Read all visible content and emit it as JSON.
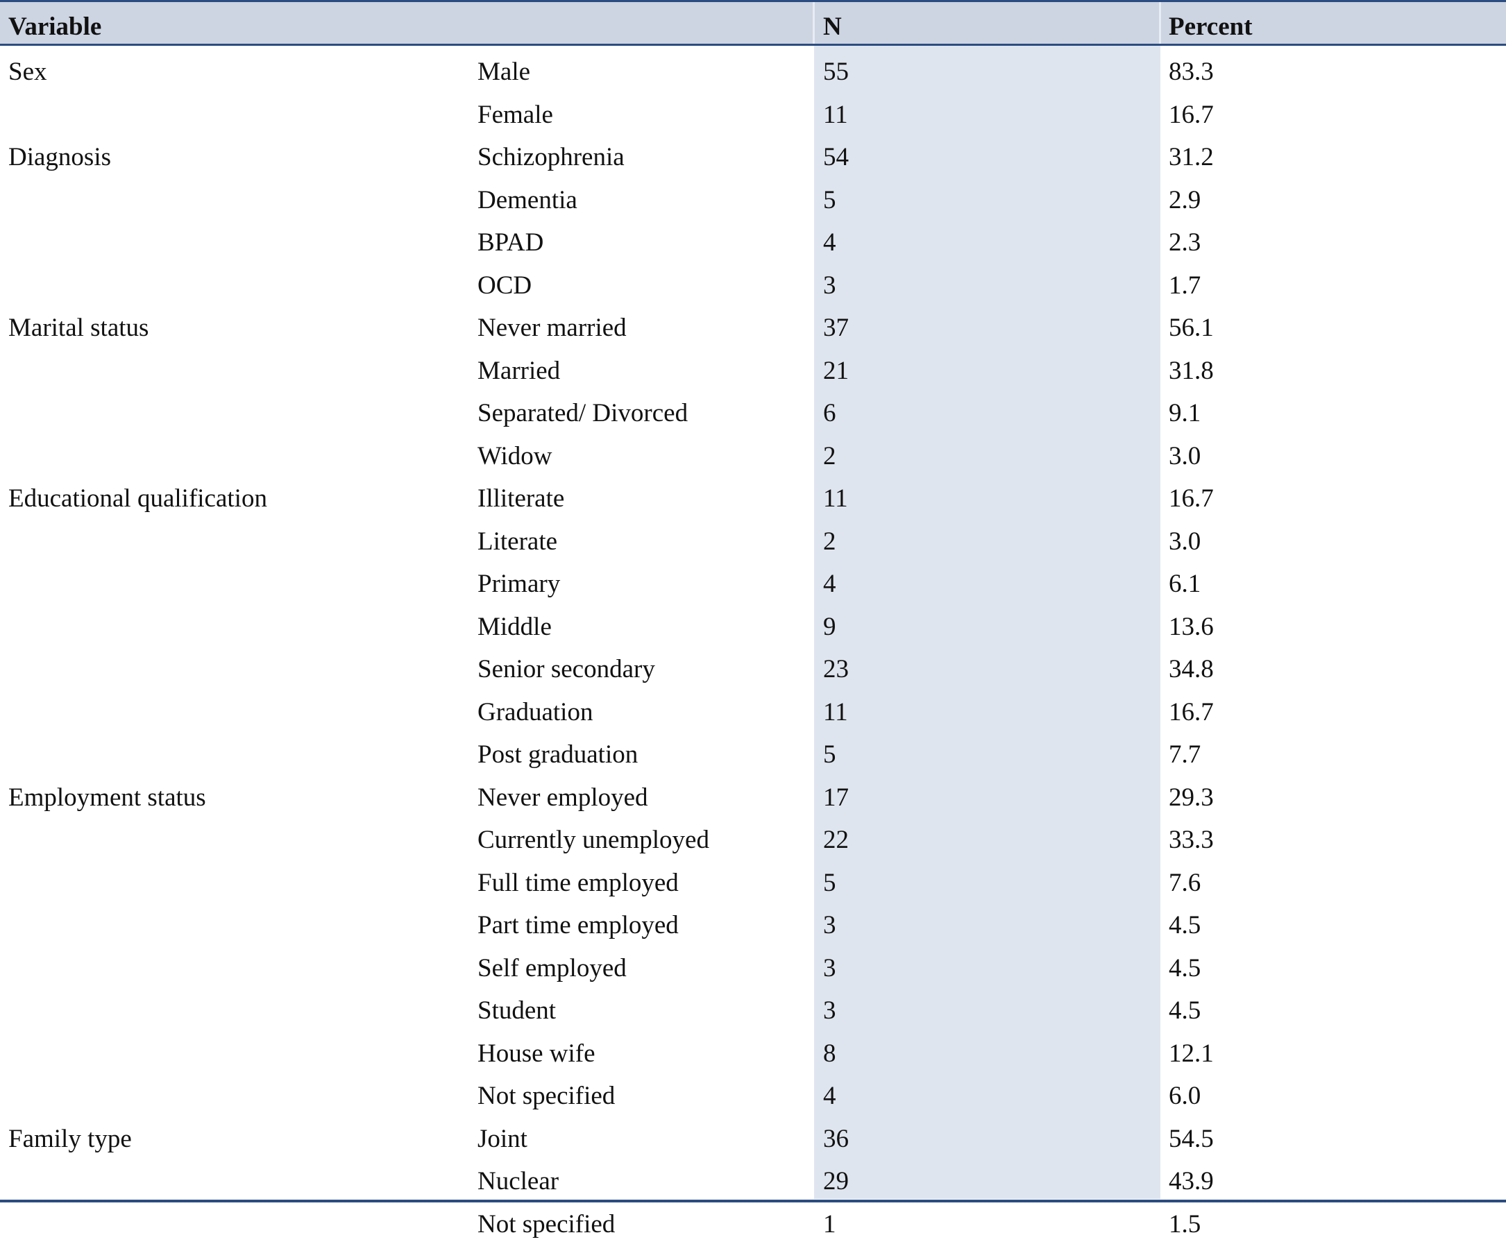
{
  "table": {
    "colors": {
      "rule": "#2b4c80",
      "header_bg": "#cdd4e2",
      "n_column_bg": "#dfe5ee"
    },
    "headers": {
      "variable": "Variable",
      "category": "",
      "n": "N",
      "percent": "Percent"
    },
    "rows": [
      {
        "variable": "Sex",
        "category": "Male",
        "n": "55",
        "percent": "83.3"
      },
      {
        "variable": "",
        "category": "Female",
        "n": "11",
        "percent": "16.7"
      },
      {
        "variable": "Diagnosis",
        "category": "Schizophrenia",
        "n": "54",
        "percent": "31.2"
      },
      {
        "variable": "",
        "category": "Dementia",
        "n": "5",
        "percent": "2.9"
      },
      {
        "variable": "",
        "category": "BPAD",
        "n": "4",
        "percent": "2.3"
      },
      {
        "variable": "",
        "category": "OCD",
        "n": "3",
        "percent": "1.7"
      },
      {
        "variable": "Marital status",
        "category": "Never married",
        "n": "37",
        "percent": "56.1"
      },
      {
        "variable": "",
        "category": "Married",
        "n": "21",
        "percent": "31.8"
      },
      {
        "variable": "",
        "category": "Separated/ Divorced",
        "n": "6",
        "percent": "9.1"
      },
      {
        "variable": "",
        "category": "Widow",
        "n": "2",
        "percent": "3.0"
      },
      {
        "variable": "Educational qualification",
        "category": "Illiterate",
        "n": "11",
        "percent": "16.7"
      },
      {
        "variable": "",
        "category": "Literate",
        "n": "2",
        "percent": "3.0"
      },
      {
        "variable": "",
        "category": "Primary",
        "n": "4",
        "percent": "6.1"
      },
      {
        "variable": "",
        "category": "Middle",
        "n": "9",
        "percent": "13.6"
      },
      {
        "variable": "",
        "category": "Senior secondary",
        "n": "23",
        "percent": "34.8"
      },
      {
        "variable": "",
        "category": "Graduation",
        "n": "11",
        "percent": "16.7"
      },
      {
        "variable": "",
        "category": "Post graduation",
        "n": "5",
        "percent": "7.7"
      },
      {
        "variable": "Employment status",
        "category": "Never employed",
        "n": "17",
        "percent": "29.3"
      },
      {
        "variable": "",
        "category": "Currently unemployed",
        "n": "22",
        "percent": "33.3"
      },
      {
        "variable": "",
        "category": "Full time employed",
        "n": "5",
        "percent": "7.6"
      },
      {
        "variable": "",
        "category": "Part time employed",
        "n": "3",
        "percent": "4.5"
      },
      {
        "variable": "",
        "category": "Self employed",
        "n": "3",
        "percent": "4.5"
      },
      {
        "variable": "",
        "category": "Student",
        "n": "3",
        "percent": "4.5"
      },
      {
        "variable": "",
        "category": "House wife",
        "n": "8",
        "percent": "12.1"
      },
      {
        "variable": "",
        "category": "Not specified",
        "n": "4",
        "percent": "6.0"
      },
      {
        "variable": "Family type",
        "category": "Joint",
        "n": "36",
        "percent": "54.5"
      },
      {
        "variable": "",
        "category": "Nuclear",
        "n": "29",
        "percent": "43.9"
      },
      {
        "variable": "",
        "category": "Not specified",
        "n": "1",
        "percent": "1.5"
      }
    ]
  }
}
